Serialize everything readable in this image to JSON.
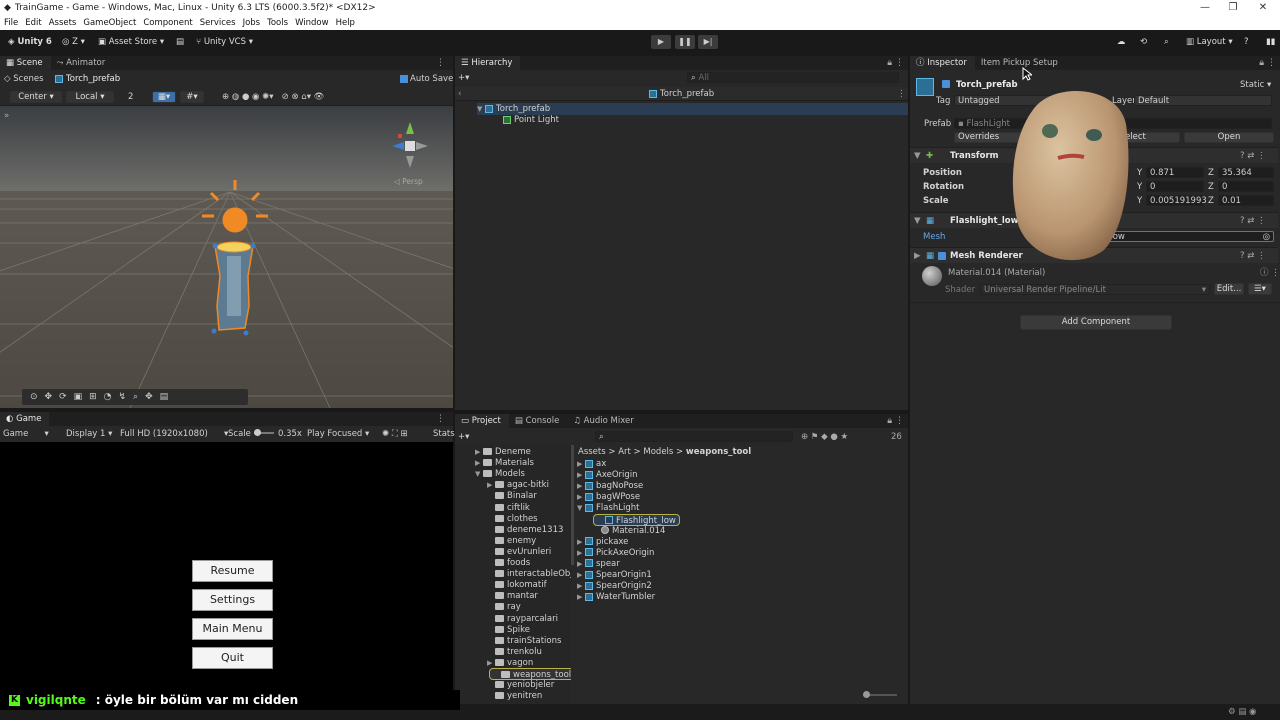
{
  "window": {
    "title": "TrainGame - Game - Windows, Mac, Linux - Unity 6.3 LTS (6000.3.5f2)* <DX12>",
    "min": "—",
    "max": "❐",
    "close": "✕"
  },
  "menu": [
    "File",
    "Edit",
    "Assets",
    "GameObject",
    "Component",
    "Services",
    "Jobs",
    "Tools",
    "Window",
    "Help"
  ],
  "toolbar": {
    "unity": "Unity 6",
    "account": "Z",
    "asset_store": "Asset Store",
    "vcs": "Unity VCS",
    "layout": "Layout",
    "play_icon": "▶",
    "pause_icon": "❚❚",
    "step_icon": "▶|"
  },
  "scene_panel": {
    "tabs": [
      "Scene",
      "Animator"
    ],
    "breadcrumb_root": "Scenes",
    "breadcrumb_item": "Torch_prefab",
    "auto_save": "Auto Save",
    "pivot": "Center",
    "space": "Local",
    "snap": "2",
    "persp": "Persp"
  },
  "hierarchy": {
    "tab": "Hierarchy",
    "search_placeholder": "All",
    "header": "Torch_prefab",
    "items": [
      "Torch_prefab",
      "Point Light"
    ]
  },
  "inspector": {
    "tabs": [
      "Inspector",
      "Item Pickup Setup"
    ],
    "object_name": "Torch_prefab",
    "static_label": "Static",
    "tag_label": "Tag",
    "tag_value": "Untagged",
    "layer_label": "Layer",
    "layer_value": "Default",
    "prefab_label": "Prefab",
    "prefab_value": "FlashLight",
    "overrides": "Overrides",
    "select": "elect",
    "open": "Open",
    "transform": {
      "title": "Transform",
      "position_label": "Position",
      "rotation_label": "Rotation",
      "scale_label": "Scale",
      "y_label": "Y",
      "z_label": "Z",
      "pos_y": "0.871",
      "pos_z": "35.364",
      "rot_y": "0",
      "rot_z": "0",
      "scale_y": "0.005191993",
      "scale_z": "0.01"
    },
    "mesh_filter": {
      "title": "Flashlight_low",
      "mesh_label": "Mesh",
      "mesh_value": "ght_low"
    },
    "mesh_renderer": {
      "title": "Mesh Renderer"
    },
    "material": {
      "name": "Material.014 (Material)",
      "shader_label": "Shader",
      "shader_value": "Universal Render Pipeline/Lit",
      "edit": "Edit..."
    },
    "add_component": "Add Component"
  },
  "game_panel": {
    "tab": "Game",
    "mode": "Game",
    "display": "Display 1",
    "resolution": "Full HD (1920x1080)",
    "scale_label": "Scale",
    "scale_value": "0.35x",
    "play_focused": "Play Focused",
    "stats": "Stats",
    "buttons": [
      "Resume",
      "Settings",
      "Main Menu",
      "Quit"
    ]
  },
  "project_panel": {
    "tabs": [
      "Project",
      "Console",
      "Audio Mixer"
    ],
    "count": "26",
    "breadcrumb": [
      "Assets",
      "Art",
      "Models",
      "weapons_tool"
    ],
    "tree": [
      "Deneme",
      "Materials",
      "Models",
      "agac-bitki",
      "Binalar",
      "ciftlik",
      "clothes",
      "deneme1313",
      "enemy",
      "evUrunleri",
      "foods",
      "interactableObje",
      "lokomatif",
      "mantar",
      "ray",
      "rayparcalari",
      "Spike",
      "trainStations",
      "trenkolu",
      "vagon",
      "weapons_tool",
      "yeniobjeler",
      "yenitren"
    ],
    "assets": [
      "ax",
      "AxeOrigin",
      "bagNoPose",
      "bagWPose",
      "FlashLight",
      "Flashlight_low",
      "Material.014",
      "pickaxe",
      "PickAxeOrigin",
      "spear",
      "SpearOrigin1",
      "SpearOrigin2",
      "WaterTumbler"
    ]
  },
  "chat": {
    "user": "vigilqnte",
    "message": ": öyle bir bölüm var mı cidden"
  },
  "colors": {
    "accent": "#3d7bcd",
    "selection": "#2c5d87",
    "orange": "#f08a24",
    "chat_green": "#53fc18"
  }
}
